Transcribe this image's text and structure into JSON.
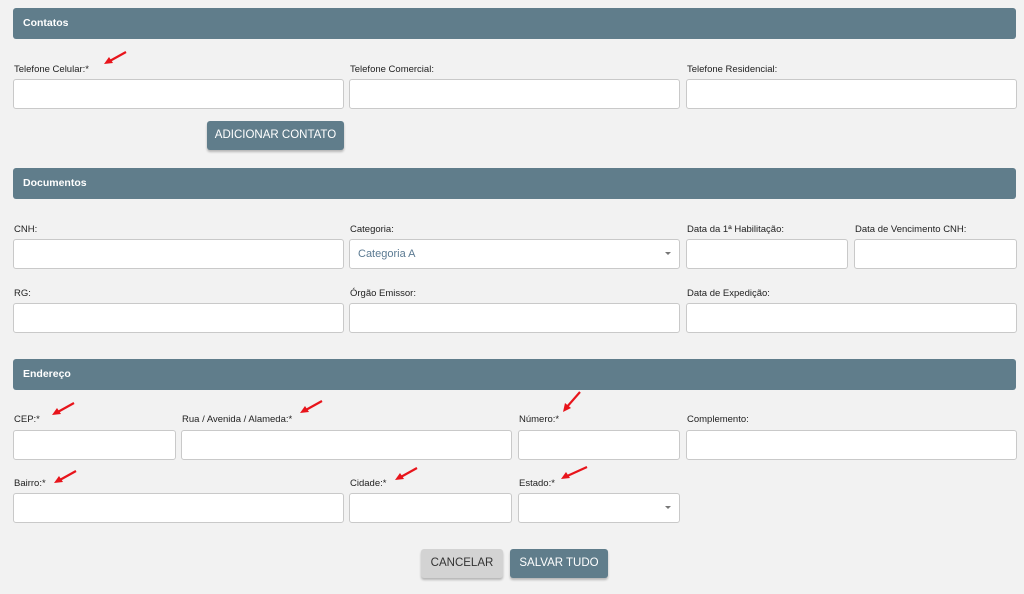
{
  "colors": {
    "section_header": "#607d8b",
    "arrow": "#e8141b"
  },
  "sections": {
    "contatos": {
      "title": "Contatos",
      "celular_label": "Telefone Celular:*",
      "comercial_label": "Telefone Comercial:",
      "residencial_label": "Telefone Residencial:",
      "add_button": "ADICIONAR CONTATO"
    },
    "documentos": {
      "title": "Documentos",
      "cnh_label": "CNH:",
      "categoria_label": "Categoria:",
      "categoria_value": "Categoria A",
      "habilitacao_label": "Data da 1ª Habilitação:",
      "vencimento_label": "Data de Vencimento CNH:",
      "rg_label": "RG:",
      "orgao_label": "Órgão Emissor:",
      "expedicao_label": "Data de Expedição:"
    },
    "endereco": {
      "title": "Endereço",
      "cep_label": "CEP:*",
      "rua_label": "Rua / Avenida / Alameda:*",
      "numero_label": "Número:*",
      "complemento_label": "Complemento:",
      "bairro_label": "Bairro:*",
      "cidade_label": "Cidade:*",
      "estado_label": "Estado:*"
    }
  },
  "actions": {
    "cancel": "CANCELAR",
    "save": "SALVAR TUDO"
  }
}
